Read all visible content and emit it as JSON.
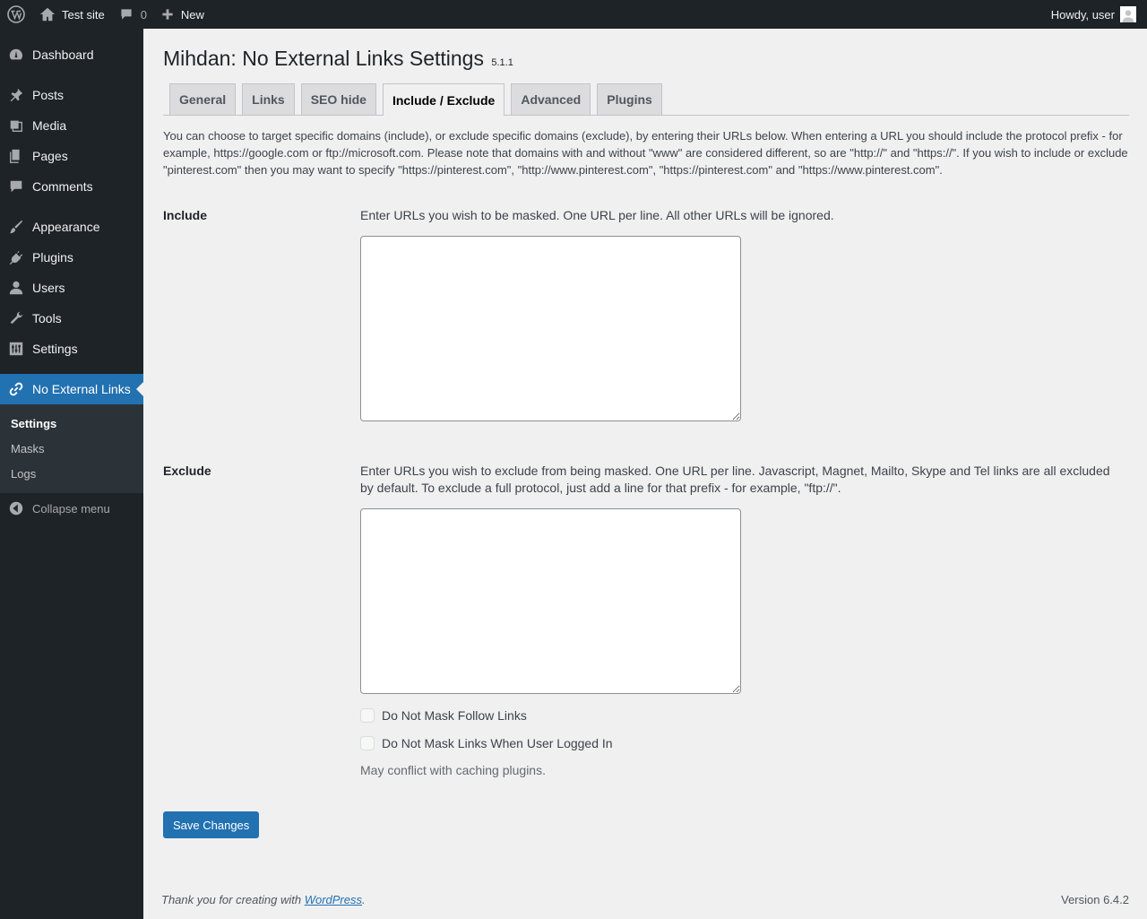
{
  "adminbar": {
    "site_name": "Test site",
    "comment_count": "0",
    "new_label": "New",
    "howdy": "Howdy, user"
  },
  "sidebar": {
    "items": [
      {
        "label": "Dashboard",
        "icon": "dashboard-icon"
      },
      {
        "label": "Posts",
        "icon": "pin-icon"
      },
      {
        "label": "Media",
        "icon": "media-icon"
      },
      {
        "label": "Pages",
        "icon": "pages-icon"
      },
      {
        "label": "Comments",
        "icon": "comment-icon"
      },
      {
        "label": "Appearance",
        "icon": "brush-icon"
      },
      {
        "label": "Plugins",
        "icon": "plug-icon"
      },
      {
        "label": "Users",
        "icon": "user-icon"
      },
      {
        "label": "Tools",
        "icon": "wrench-icon"
      },
      {
        "label": "Settings",
        "icon": "settings-icon"
      },
      {
        "label": "No External Links",
        "icon": "link-icon"
      }
    ],
    "submenu": [
      "Settings",
      "Masks",
      "Logs"
    ],
    "collapse": "Collapse menu"
  },
  "page": {
    "title": "Mihdan: No External Links Settings",
    "version": "5.1.1",
    "tabs": [
      "General",
      "Links",
      "SEO hide",
      "Include / Exclude",
      "Advanced",
      "Plugins"
    ],
    "active_tab": "Include / Exclude",
    "intro": "You can choose to target specific domains (include), or exclude specific domains (exclude), by entering their URLs below. When entering a URL you should include the protocol prefix - for example, https://google.com or ftp://microsoft.com. Please note that domains with and without \"www\" are considered different, so are \"http://\" and \"https://\". If you wish to include or exclude \"pinterest.com\" then you may want to specify \"https://pinterest.com\", \"http://www.pinterest.com\", \"https://pinterest.com\" and \"https://www.pinterest.com\".",
    "include": {
      "label": "Include",
      "description": "Enter URLs you wish to be masked. One URL per line. All other URLs will be ignored.",
      "value": ""
    },
    "exclude": {
      "label": "Exclude",
      "description": "Enter URLs you wish to exclude from being masked. One URL per line. Javascript, Magnet, Mailto, Skype and Tel links are all excluded by default. To exclude a full protocol, just add a line for that prefix - for example, \"ftp://\".",
      "value": ""
    },
    "checkboxes": [
      {
        "label": "Do Not Mask Follow Links",
        "checked": false
      },
      {
        "label": "Do Not Mask Links When User Logged In",
        "checked": false
      }
    ],
    "note": "May conflict with caching plugins.",
    "save_label": "Save Changes"
  },
  "footer": {
    "thanks_prefix": "Thank you for creating with ",
    "thanks_link": "WordPress",
    "thanks_suffix": ".",
    "version": "Version 6.4.2"
  },
  "colors": {
    "adminbar": "#1d2327",
    "accent": "#2271b1",
    "background": "#f0f0f1"
  }
}
